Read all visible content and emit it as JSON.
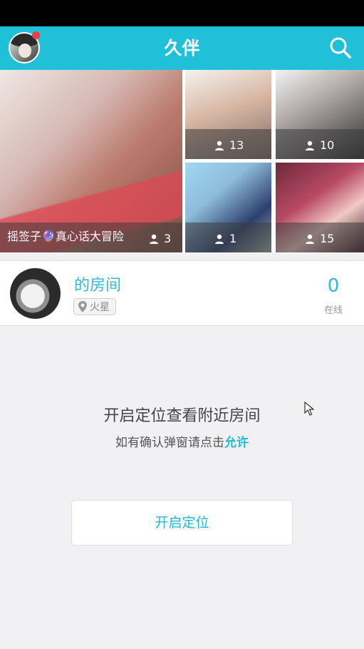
{
  "header": {
    "title": "久伴",
    "accent_color": "#20c0d8"
  },
  "banner": {
    "big_tile": {
      "caption": "摇签子🔮真心话大冒险",
      "count": "3",
      "theme": "#c98f8a"
    },
    "tiles": [
      {
        "count": "13",
        "theme": "#d7b7a3"
      },
      {
        "count": "10",
        "theme": "#b8b1b1"
      },
      {
        "count": "1",
        "theme": "#8fbcd8"
      },
      {
        "count": "15",
        "theme": "#b84a63"
      }
    ]
  },
  "room": {
    "name": "的房间",
    "location": "火星",
    "online_count": "0",
    "online_label": "在线"
  },
  "location_prompt": {
    "title": "开启定位查看附近房间",
    "subtitle_prefix": "如有确认弹窗请点击",
    "subtitle_highlight": "允许",
    "button_label": "开启定位"
  }
}
